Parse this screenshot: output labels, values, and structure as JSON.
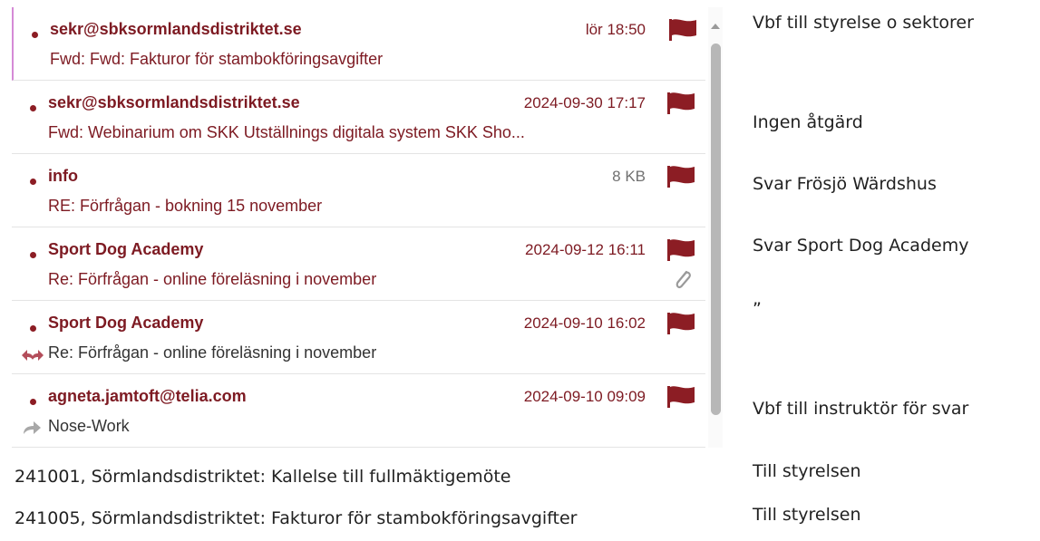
{
  "mail_list": {
    "items": [
      {
        "sender": "sekr@sbksormlandsdistriktet.se",
        "meta": "lör 18:50",
        "subject": "Fwd: Fwd: Fakturor för stambokföringsavgifter"
      },
      {
        "sender": "sekr@sbksormlandsdistriktet.se",
        "meta": "2024-09-30 17:17",
        "subject": "Fwd: Webinarium om SKK Utställnings digitala system SKK Sho..."
      },
      {
        "sender": "info",
        "meta": "8 KB",
        "subject": "RE: Förfrågan - bokning 15 november"
      },
      {
        "sender": "Sport Dog Academy",
        "meta": "2024-09-12 16:11",
        "subject": "Re: Förfrågan - online föreläsning i november"
      },
      {
        "sender": "Sport Dog Academy",
        "meta": "2024-09-10 16:02",
        "subject": "Re: Förfrågan - online föreläsning i november"
      },
      {
        "sender": "agneta.jamtoft@telia.com",
        "meta": "2024-09-10 09:09",
        "subject": "Nose-Work"
      }
    ]
  },
  "notes": [
    "Vbf till styrelse o sektorer",
    "Ingen åtgärd",
    "Svar Frösjö Wärdshus",
    "Svar Sport Dog Academy",
    "”",
    "Vbf till instruktör för svar",
    "Till styrelsen",
    "Till styrelsen"
  ],
  "bottom_lines": [
    "241001, Sörmlandsdistriktet: Kallelse till fullmäktigemöte",
    "241005, Sörmlandsdistriktet: Fakturor för stambokföringsavgifter"
  ],
  "colors": {
    "accent": "#7d1a22",
    "flag": "#8c1d24",
    "selected_border": "#d58ad6",
    "scroll_thumb": "#b7b7b7"
  },
  "icons": {
    "flag": "flag-icon",
    "attachment": "paperclip-icon",
    "reply_forward": "reply-forward-icon",
    "forward": "forward-icon",
    "scroll_up": "chevron-up-icon"
  }
}
